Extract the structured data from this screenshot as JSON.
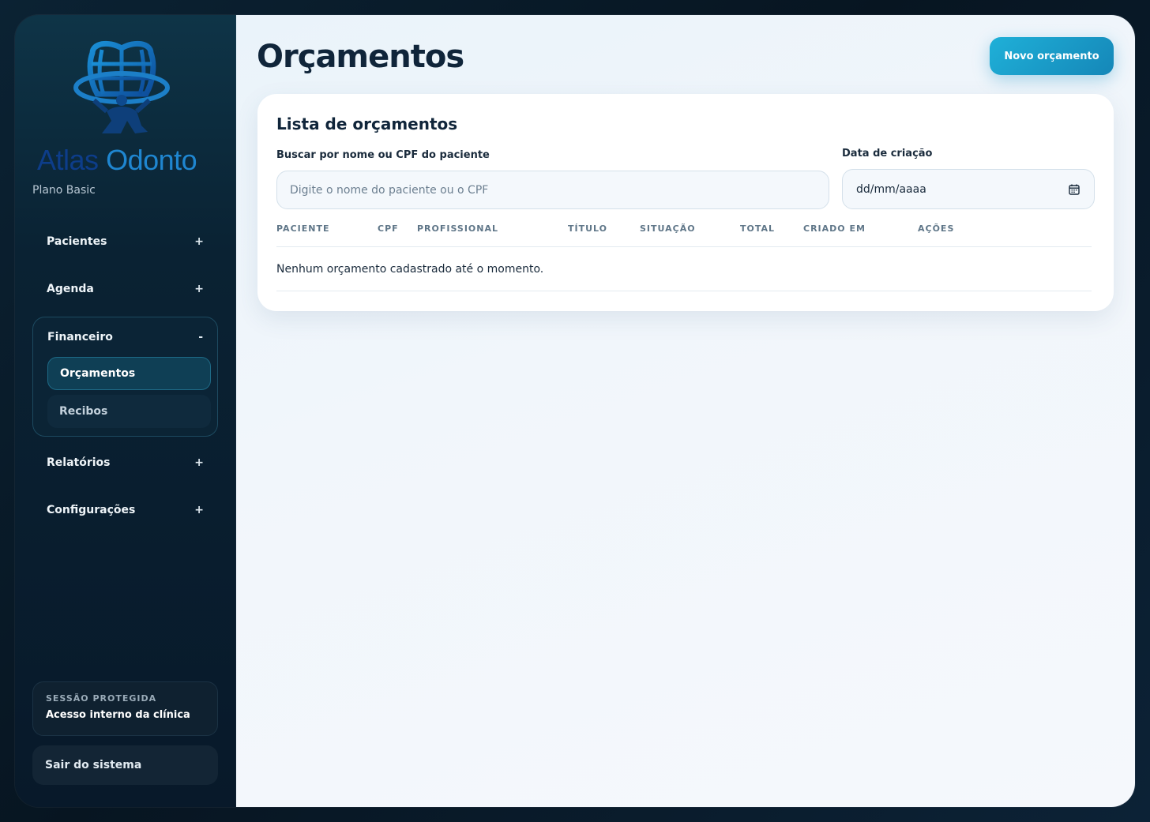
{
  "app": {
    "logo_word1": "Atlas",
    "logo_word2": "Odonto",
    "plan": "Plano Basic"
  },
  "sidebar": {
    "items": [
      {
        "label": "Pacientes",
        "toggle": "+"
      },
      {
        "label": "Agenda",
        "toggle": "+"
      },
      {
        "label": "Financeiro",
        "toggle": "-",
        "children": [
          {
            "label": "Orçamentos",
            "active": true
          },
          {
            "label": "Recibos",
            "active": false
          }
        ]
      },
      {
        "label": "Relatórios",
        "toggle": "+"
      },
      {
        "label": "Configurações",
        "toggle": "+"
      }
    ],
    "session": {
      "caption": "SESSÃO PROTEGIDA",
      "value": "Acesso interno da clínica"
    },
    "logout_label": "Sair do sistema"
  },
  "header": {
    "title": "Orçamentos",
    "new_button_label": "Novo orçamento"
  },
  "list": {
    "title": "Lista de orçamentos",
    "search_label": "Buscar por nome ou CPF do paciente",
    "search_placeholder": "Digite o nome do paciente ou o CPF",
    "search_value": "",
    "date_label": "Data de criação",
    "date_placeholder": "dd/mm/aaaa",
    "columns": [
      "PACIENTE",
      "CPF",
      "PROFISSIONAL",
      "TÍTULO",
      "SITUAÇÃO",
      "TOTAL",
      "CRIADO EM",
      "AÇÕES"
    ],
    "empty_message": "Nenhum orçamento cadastrado até o momento."
  },
  "colors": {
    "accent": "#1fb0d8",
    "sidebar_bg": "#0a2233",
    "main_bg": "#f1f6fb",
    "text_dark": "#10253a"
  },
  "icons": {
    "logo": "tooth-globe-atlas-logo",
    "date_picker": "calendar-icon"
  }
}
